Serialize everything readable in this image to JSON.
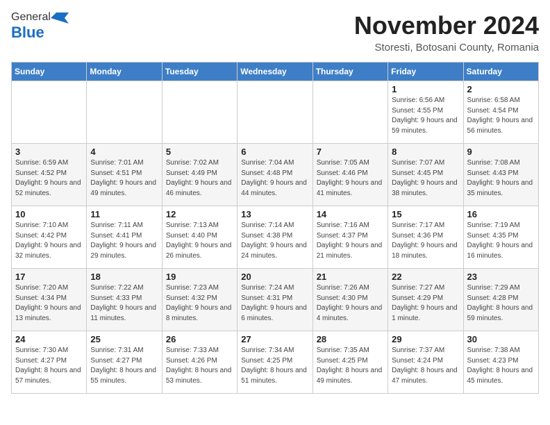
{
  "logo": {
    "general": "General",
    "blue": "Blue"
  },
  "title": {
    "month": "November 2024",
    "location": "Storesti, Botosani County, Romania"
  },
  "weekdays": [
    "Sunday",
    "Monday",
    "Tuesday",
    "Wednesday",
    "Thursday",
    "Friday",
    "Saturday"
  ],
  "weeks": [
    [
      {
        "day": "",
        "info": ""
      },
      {
        "day": "",
        "info": ""
      },
      {
        "day": "",
        "info": ""
      },
      {
        "day": "",
        "info": ""
      },
      {
        "day": "",
        "info": ""
      },
      {
        "day": "1",
        "info": "Sunrise: 6:56 AM\nSunset: 4:55 PM\nDaylight: 9 hours and 59 minutes."
      },
      {
        "day": "2",
        "info": "Sunrise: 6:58 AM\nSunset: 4:54 PM\nDaylight: 9 hours and 56 minutes."
      }
    ],
    [
      {
        "day": "3",
        "info": "Sunrise: 6:59 AM\nSunset: 4:52 PM\nDaylight: 9 hours and 52 minutes."
      },
      {
        "day": "4",
        "info": "Sunrise: 7:01 AM\nSunset: 4:51 PM\nDaylight: 9 hours and 49 minutes."
      },
      {
        "day": "5",
        "info": "Sunrise: 7:02 AM\nSunset: 4:49 PM\nDaylight: 9 hours and 46 minutes."
      },
      {
        "day": "6",
        "info": "Sunrise: 7:04 AM\nSunset: 4:48 PM\nDaylight: 9 hours and 44 minutes."
      },
      {
        "day": "7",
        "info": "Sunrise: 7:05 AM\nSunset: 4:46 PM\nDaylight: 9 hours and 41 minutes."
      },
      {
        "day": "8",
        "info": "Sunrise: 7:07 AM\nSunset: 4:45 PM\nDaylight: 9 hours and 38 minutes."
      },
      {
        "day": "9",
        "info": "Sunrise: 7:08 AM\nSunset: 4:43 PM\nDaylight: 9 hours and 35 minutes."
      }
    ],
    [
      {
        "day": "10",
        "info": "Sunrise: 7:10 AM\nSunset: 4:42 PM\nDaylight: 9 hours and 32 minutes."
      },
      {
        "day": "11",
        "info": "Sunrise: 7:11 AM\nSunset: 4:41 PM\nDaylight: 9 hours and 29 minutes."
      },
      {
        "day": "12",
        "info": "Sunrise: 7:13 AM\nSunset: 4:40 PM\nDaylight: 9 hours and 26 minutes."
      },
      {
        "day": "13",
        "info": "Sunrise: 7:14 AM\nSunset: 4:38 PM\nDaylight: 9 hours and 24 minutes."
      },
      {
        "day": "14",
        "info": "Sunrise: 7:16 AM\nSunset: 4:37 PM\nDaylight: 9 hours and 21 minutes."
      },
      {
        "day": "15",
        "info": "Sunrise: 7:17 AM\nSunset: 4:36 PM\nDaylight: 9 hours and 18 minutes."
      },
      {
        "day": "16",
        "info": "Sunrise: 7:19 AM\nSunset: 4:35 PM\nDaylight: 9 hours and 16 minutes."
      }
    ],
    [
      {
        "day": "17",
        "info": "Sunrise: 7:20 AM\nSunset: 4:34 PM\nDaylight: 9 hours and 13 minutes."
      },
      {
        "day": "18",
        "info": "Sunrise: 7:22 AM\nSunset: 4:33 PM\nDaylight: 9 hours and 11 minutes."
      },
      {
        "day": "19",
        "info": "Sunrise: 7:23 AM\nSunset: 4:32 PM\nDaylight: 9 hours and 8 minutes."
      },
      {
        "day": "20",
        "info": "Sunrise: 7:24 AM\nSunset: 4:31 PM\nDaylight: 9 hours and 6 minutes."
      },
      {
        "day": "21",
        "info": "Sunrise: 7:26 AM\nSunset: 4:30 PM\nDaylight: 9 hours and 4 minutes."
      },
      {
        "day": "22",
        "info": "Sunrise: 7:27 AM\nSunset: 4:29 PM\nDaylight: 9 hours and 1 minute."
      },
      {
        "day": "23",
        "info": "Sunrise: 7:29 AM\nSunset: 4:28 PM\nDaylight: 8 hours and 59 minutes."
      }
    ],
    [
      {
        "day": "24",
        "info": "Sunrise: 7:30 AM\nSunset: 4:27 PM\nDaylight: 8 hours and 57 minutes."
      },
      {
        "day": "25",
        "info": "Sunrise: 7:31 AM\nSunset: 4:27 PM\nDaylight: 8 hours and 55 minutes."
      },
      {
        "day": "26",
        "info": "Sunrise: 7:33 AM\nSunset: 4:26 PM\nDaylight: 8 hours and 53 minutes."
      },
      {
        "day": "27",
        "info": "Sunrise: 7:34 AM\nSunset: 4:25 PM\nDaylight: 8 hours and 51 minutes."
      },
      {
        "day": "28",
        "info": "Sunrise: 7:35 AM\nSunset: 4:25 PM\nDaylight: 8 hours and 49 minutes."
      },
      {
        "day": "29",
        "info": "Sunrise: 7:37 AM\nSunset: 4:24 PM\nDaylight: 8 hours and 47 minutes."
      },
      {
        "day": "30",
        "info": "Sunrise: 7:38 AM\nSunset: 4:23 PM\nDaylight: 8 hours and 45 minutes."
      }
    ]
  ]
}
